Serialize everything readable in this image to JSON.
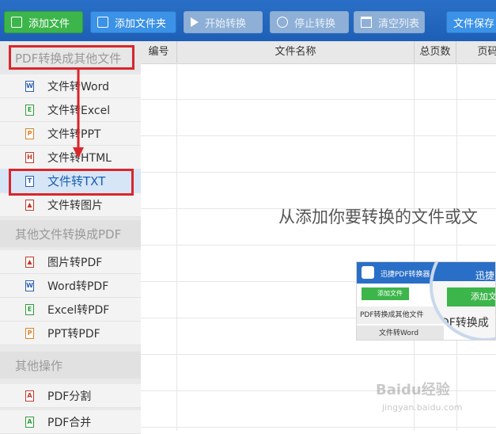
{
  "toolbar": {
    "add_file": "添加文件",
    "add_folder": "添加文件夹",
    "start": "开始转换",
    "stop": "停止转换",
    "clear": "清空列表",
    "save_path": "文件保存"
  },
  "sidebar": {
    "section1": "PDF转换成其他文件",
    "items1": [
      "文件转Word",
      "文件转Excel",
      "文件转PPT",
      "文件转HTML",
      "文件转TXT",
      "文件转图片"
    ],
    "section2": "其他文件转换成PDF",
    "items2": [
      "图片转PDF",
      "Word转PDF",
      "Excel转PDF",
      "PPT转PDF"
    ],
    "section3": "其他操作",
    "items3": [
      "PDF分割",
      "PDF合并"
    ]
  },
  "table": {
    "headers": [
      "编号",
      "文件名称",
      "总页数",
      "页码"
    ]
  },
  "hint": "从添加你要转换的文件或文",
  "preview": {
    "app_title": "迅捷PDF转换器",
    "add_file": "添加文件",
    "section": "PDF转换成其他文件",
    "item": "文件转Word",
    "mag_title": "迅捷",
    "mag_button": "添加文件",
    "mag_section": "DF转换成"
  },
  "watermark": {
    "logo": "Baidu经验",
    "url": "jingyan.baidu.com"
  },
  "colors": {
    "toolbar": "#1d5fb6",
    "highlight": "#d9262b",
    "green": "#3cb54a"
  }
}
